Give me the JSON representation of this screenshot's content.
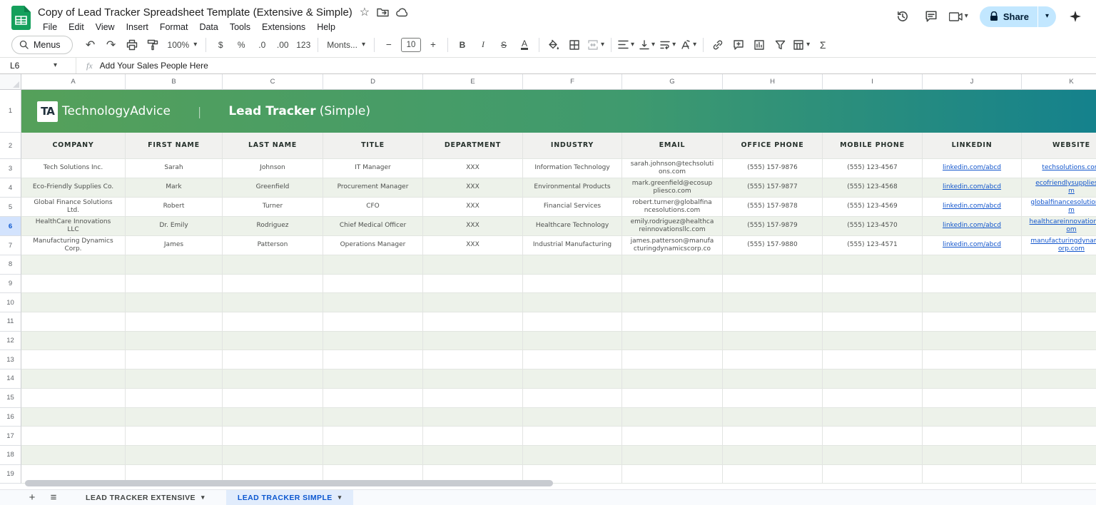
{
  "titlebar": {
    "title": "Copy of Lead Tracker Spreadsheet Template (Extensive & Simple)",
    "star": "☆",
    "menus": [
      "File",
      "Edit",
      "View",
      "Insert",
      "Format",
      "Data",
      "Tools",
      "Extensions",
      "Help"
    ],
    "share_label": "Share",
    "caret": "▾"
  },
  "toolbar": {
    "menus_label": "Menus",
    "undo": "↶",
    "redo": "↷",
    "zoom_value": "100%",
    "currency": "$",
    "percent": "%",
    "decimal_decrease": ".0",
    "decimal_increase": ".00",
    "more_formats": "123",
    "font_name": "Monts...",
    "font_size": "10",
    "minus": "−",
    "plus": "+",
    "bold": "B",
    "italic": "I",
    "strikethrough": "S",
    "text_color": "A",
    "functions": "Σ",
    "caret": "▾"
  },
  "formula_bar": {
    "cell_ref": "L6",
    "fx": "fx",
    "content": "Add Your Sales People Here",
    "caret": "▾"
  },
  "grid": {
    "columns": [
      "A",
      "B",
      "C",
      "D",
      "E",
      "F",
      "G",
      "H",
      "I",
      "J",
      "K"
    ],
    "row_numbers": [
      "1",
      "2",
      "3",
      "4",
      "5",
      "6",
      "7",
      "8",
      "9",
      "10",
      "11",
      "12",
      "13",
      "14",
      "15",
      "16",
      "17",
      "18",
      "19"
    ],
    "selected_row": "6",
    "empty_rows_start": 8,
    "empty_rows_end": 19
  },
  "banner": {
    "logo_text": "TA",
    "brand": "TechnologyAdvice",
    "separator": "|",
    "title_bold": "Lead Tracker",
    "title_light": "(Simple)",
    "gradient_left": "#55a05a",
    "gradient_right": "#12808e"
  },
  "table": {
    "headers": [
      "COMPANY",
      "FIRST NAME",
      "LAST NAME",
      "TITLE",
      "DEPARTMENT",
      "INDUSTRY",
      "EMAIL",
      "OFFICE PHONE",
      "MOBILE PHONE",
      "LINKEDIN",
      "WEBSITE"
    ],
    "rows": [
      {
        "company": "Tech Solutions Inc.",
        "first_name": "Sarah",
        "last_name": "Johnson",
        "title": "IT Manager",
        "department": "XXX",
        "industry": "Information Technology",
        "email": "sarah.johnson@techsoluti\nons.com",
        "office_phone": "(555) 157-9876",
        "mobile_phone": "(555) 123-4567",
        "linkedin": "linkedin.com/abcd",
        "website": "techsolutions.com"
      },
      {
        "company": "Eco-Friendly Supplies Co.",
        "first_name": "Mark",
        "last_name": "Greenfield",
        "title": "Procurement Manager",
        "department": "XXX",
        "industry": "Environmental Products",
        "email": "mark.greenfield@ecosup\npliesco.com",
        "office_phone": "(555) 157-9877",
        "mobile_phone": "(555) 123-4568",
        "linkedin": "linkedin.com/abcd",
        "website": "ecofriendlysupplies.co\nm"
      },
      {
        "company": "Global Finance Solutions\nLtd.",
        "first_name": "Robert",
        "last_name": "Turner",
        "title": "CFO",
        "department": "XXX",
        "industry": "Financial Services",
        "email": "robert.turner@globalfina\nncesolutions.com",
        "office_phone": "(555) 157-9878",
        "mobile_phone": "(555) 123-4569",
        "linkedin": "linkedin.com/abcd",
        "website": "globalfinancesolutions.co\nm"
      },
      {
        "company": "HealthCare Innovations\nLLC",
        "first_name": "Dr. Emily",
        "last_name": "Rodriguez",
        "title": "Chief Medical Officer",
        "department": "XXX",
        "industry": "Healthcare Technology",
        "email": "emily.rodriguez@healthca\nreinnovationsllc.com",
        "office_phone": "(555) 157-9879",
        "mobile_phone": "(555) 123-4570",
        "linkedin": "linkedin.com/abcd",
        "website": "healthcareinnovationsllc.c\nom"
      },
      {
        "company": "Manufacturing Dynamics\nCorp.",
        "first_name": "James",
        "last_name": "Patterson",
        "title": "Operations Manager",
        "department": "XXX",
        "industry": "Industrial Manufacturing",
        "email": "james.patterson@manufa\ncturingdynamicscorp.co",
        "office_phone": "(555) 157-9880",
        "mobile_phone": "(555) 123-4571",
        "linkedin": "linkedin.com/abcd",
        "website": "manufacturingdynamicsc\norp.com"
      }
    ]
  },
  "sheet_tabs": {
    "plus": "+",
    "hamburger": "≡",
    "caret": "▾",
    "tabs": [
      {
        "label": "LEAD TRACKER EXTENSIVE",
        "active": false
      },
      {
        "label": "LEAD TRACKER SIMPLE",
        "active": true
      }
    ]
  }
}
